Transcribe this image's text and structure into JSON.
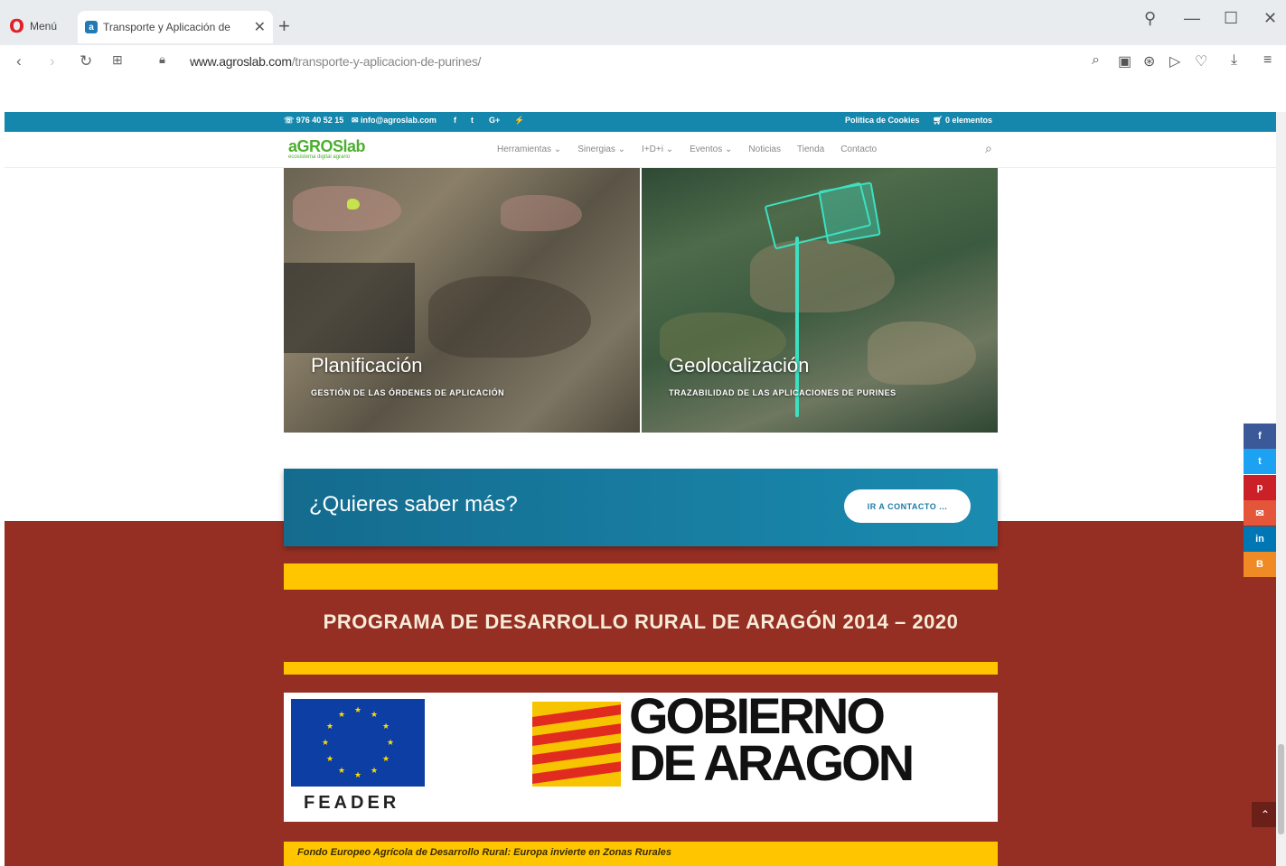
{
  "browser": {
    "menu_label": "Menú",
    "tab_title": "Transporte y Aplicación de",
    "url_domain": "www.agroslab.com",
    "url_path": "/transporte-y-aplicacion-de-purines/"
  },
  "topbar": {
    "phone": "976 40 52 15",
    "email": "info@agroslab.com",
    "social_icons": [
      "facebook-icon",
      "twitter-icon",
      "google-plus-icon",
      "rss-icon"
    ],
    "cookies_label": "Política de Cookies",
    "cart_label": "0 elementos"
  },
  "header": {
    "logo": "aGROSlab",
    "logo_tagline": "ecosistema digital agrario",
    "menu": [
      "Herramientas ⌄",
      "Sinergias ⌄",
      "I+D+i ⌄",
      "Eventos ⌄",
      "Noticias",
      "Tienda",
      "Contacto"
    ]
  },
  "hero": {
    "left_title": "Planificación",
    "left_subtitle": "GESTIÓN DE LAS ÓRDENES DE APLICACIÓN",
    "right_title": "Geolocalización",
    "right_subtitle": "TRAZABILIDAD DE LAS APLICACIONES DE PURINES"
  },
  "cta": {
    "title": "¿Quieres saber más?",
    "button": "IR A CONTACTO ..."
  },
  "program": {
    "title": "PROGRAMA DE DESARROLLO RURAL DE ARAGÓN 2014 – 2020"
  },
  "logos": {
    "feader": "FEADER",
    "gobierno_line1": "GOBIERNO",
    "gobierno_line2": "DE ARAGON"
  },
  "footer_note": "Fondo Europeo Agrícola de Desarrollo Rural: Europa invierte en Zonas Rurales",
  "colors": {
    "topbar": "#1587ac",
    "red_section": "#962f23",
    "yellow": "#ffc600",
    "logo_green": "#4caf2e"
  }
}
